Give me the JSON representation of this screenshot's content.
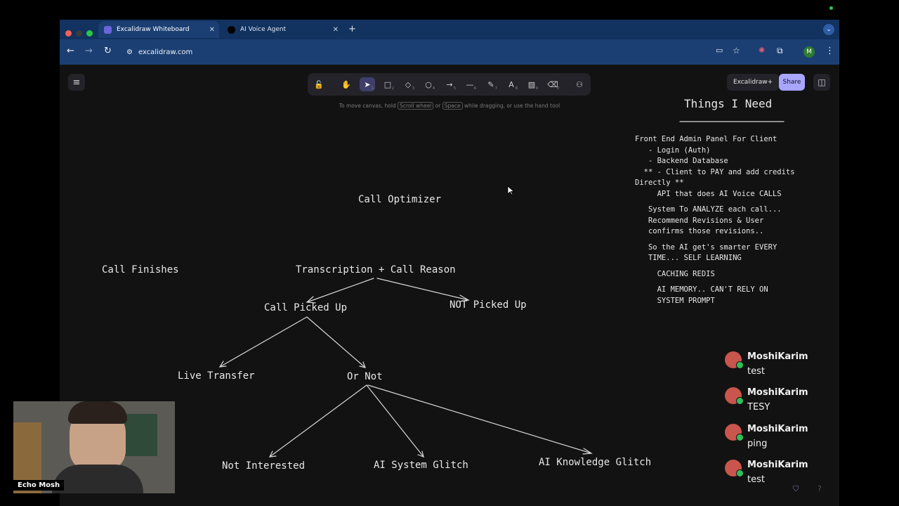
{
  "browser": {
    "tabs": [
      {
        "title": "Excalidraw Whiteboard",
        "active": true
      },
      {
        "title": "AI Voice Agent",
        "active": false
      }
    ],
    "url": "excalidraw.com",
    "profile_initial": "M"
  },
  "toolbar": {
    "tools": [
      {
        "icon": "lock-icon",
        "glyph": "🔓",
        "shortcut": ""
      },
      {
        "icon": "hand-icon",
        "glyph": "✋",
        "shortcut": ""
      },
      {
        "icon": "pointer-icon",
        "glyph": "➤",
        "shortcut": "1",
        "selected": true
      },
      {
        "icon": "rectangle-icon",
        "glyph": "□",
        "shortcut": "2"
      },
      {
        "icon": "diamond-icon",
        "glyph": "◇",
        "shortcut": "3"
      },
      {
        "icon": "ellipse-icon",
        "glyph": "○",
        "shortcut": "4"
      },
      {
        "icon": "arrow-icon",
        "glyph": "→",
        "shortcut": "5"
      },
      {
        "icon": "line-icon",
        "glyph": "—",
        "shortcut": "6"
      },
      {
        "icon": "pencil-icon",
        "glyph": "✎",
        "shortcut": "7"
      },
      {
        "icon": "text-icon",
        "glyph": "A",
        "shortcut": "8"
      },
      {
        "icon": "image-icon",
        "glyph": "▨",
        "shortcut": "9"
      },
      {
        "icon": "eraser-icon",
        "glyph": "⌫",
        "shortcut": "0"
      },
      {
        "icon": "shapes-icon",
        "glyph": "⚇",
        "shortcut": ""
      }
    ],
    "hint_pre": "To move canvas, hold",
    "hint_key1": "Scroll wheel",
    "hint_or": "or",
    "hint_key2": "Space",
    "hint_post": "while dragging, or use the hand tool"
  },
  "header": {
    "excalidraw_plus": "Excalidraw+",
    "share": "Share"
  },
  "canvas": {
    "call_optimizer": "Call Optimizer",
    "call_finishes": "Call Finishes",
    "transcription": "Transcription + Call Reason",
    "call_picked_up": "Call Picked Up",
    "not_picked_up": "NOT Picked Up",
    "live_transfer": "Live Transfer",
    "or_not": "Or Not",
    "not_interested": "Not Interested",
    "ai_system_glitch": "AI System Glitch",
    "ai_knowledge_glitch": "AI Knowledge Glitch"
  },
  "notes": {
    "title": "Things I Need",
    "lines": [
      "Front End Admin Panel For Client",
      "   - Login (Auth)",
      "   - Backend Database",
      "  ** - Client to PAY and add credits",
      "Directly **",
      "     API that does AI Voice CALLS",
      "",
      "   System To ANALYZE each call...",
      "   Recommend Revisions & User",
      "   confirms those revisions..",
      "",
      "   So the AI get's smarter EVERY",
      "   TIME... SELF LEARNING",
      "",
      "     CACHING REDIS",
      "",
      "     AI MEMORY.. CAN'T RELY ON",
      "     SYSTEM PROMPT"
    ]
  },
  "chat": [
    {
      "user": "MoshiKarim",
      "text": "test"
    },
    {
      "user": "MoshiKarim",
      "text": "TESY"
    },
    {
      "user": "MoshiKarim",
      "text": "ping"
    },
    {
      "user": "MoshiKarim",
      "text": "test"
    }
  ],
  "webcam": {
    "name": "Echo Mosh"
  }
}
